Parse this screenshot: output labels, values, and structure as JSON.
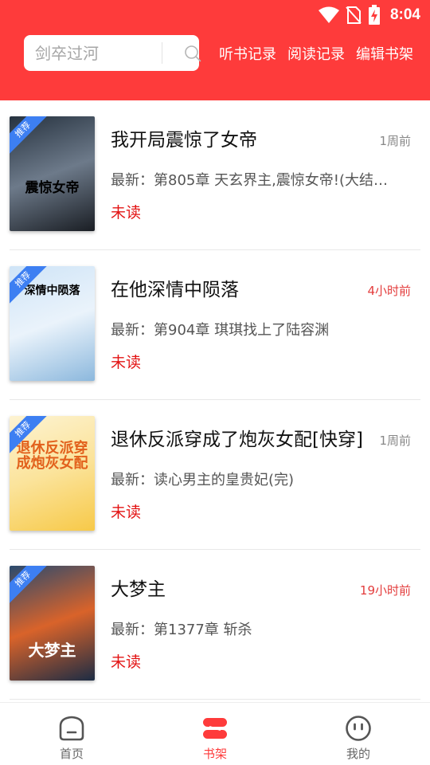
{
  "status_bar": {
    "time": "8:04",
    "icons": [
      "wifi-icon",
      "no-sim-icon",
      "battery-charging-icon"
    ]
  },
  "header": {
    "search_placeholder": "剑卒过河",
    "links": [
      "听书记录",
      "阅读记录",
      "编辑书架"
    ]
  },
  "colors": {
    "brand": "#fe3b3b",
    "unread": "#e31414",
    "time_recent": "#e33c3c",
    "time_old": "#888888"
  },
  "books": [
    {
      "title": "我开局震惊了女帝",
      "time": "1周前",
      "time_color": "#888888",
      "latest": "最新：第805章 天玄界主,震惊女帝!(大结局...",
      "status": "未读",
      "badge": "推荐",
      "cover_text": "震惊女帝",
      "cover_colors": [
        "#26323f",
        "#6d7a8a",
        "#1a1e24"
      ]
    },
    {
      "title": "在他深情中陨落",
      "time": "4小时前",
      "time_color": "#e33c3c",
      "latest": "最新：第904章 琪琪找上了陆容渊",
      "status": "未读",
      "badge": "推荐",
      "cover_text": "深情中陨落",
      "cover_colors": [
        "#cfe4f7",
        "#eaf3fb",
        "#8cb8dd"
      ]
    },
    {
      "title": "退休反派穿成了炮灰女配[快穿]",
      "time": "1周前",
      "time_color": "#888888",
      "latest": "最新：读心男主的皇贵妃(完)",
      "status": "未读",
      "badge": "推荐",
      "cover_text": "退休反派穿成炮灰女配",
      "cover_colors": [
        "#fdf3d2",
        "#fbe39a",
        "#f7c948"
      ]
    },
    {
      "title": "大梦主",
      "time": "19小时前",
      "time_color": "#e33c3c",
      "latest": "最新：第1377章 斩杀",
      "status": "未读",
      "badge": "推荐",
      "cover_text": "大梦主",
      "cover_colors": [
        "#2a4a6e",
        "#d9632a",
        "#1c2c44"
      ]
    }
  ],
  "bottom_nav": [
    {
      "label": "首页",
      "icon": "home-icon",
      "active": false
    },
    {
      "label": "书架",
      "icon": "bookshelf-icon",
      "active": true
    },
    {
      "label": "我的",
      "icon": "profile-face-icon",
      "active": false
    }
  ]
}
